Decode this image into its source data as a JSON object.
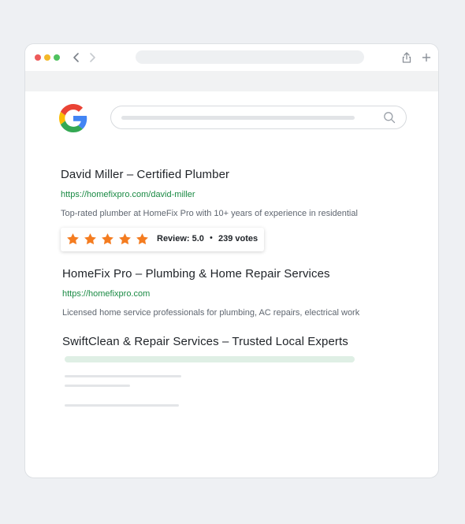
{
  "browser": {
    "traffic_lights": [
      "#ed5a5a",
      "#f3b829",
      "#4fc25f"
    ]
  },
  "search": {
    "engine_logo": "google-g-icon"
  },
  "results": [
    {
      "title": "David Miller – Certified Plumber",
      "url": "https://homefixpro.com/david-miller",
      "snippet": "Top-rated plumber at HomeFix Pro with 10+ years of experience in residential",
      "rating": {
        "stars": 5,
        "review_label": "Review: 5.0",
        "separator": "•",
        "votes_label": "239 votes",
        "star_color": "#f47c20"
      }
    },
    {
      "title": "HomeFix Pro – Plumbing & Home Repair Services",
      "url": "https://homefixpro.com",
      "snippet": "Licensed home service professionals for plumbing, AC repairs, electrical work"
    },
    {
      "title": "SwiftClean & Repair Services – Trusted Local Experts"
    }
  ],
  "colors": {
    "url_green": "#1a8a44",
    "title_text": "#1f2328",
    "snippet_text": "#5f6670"
  }
}
